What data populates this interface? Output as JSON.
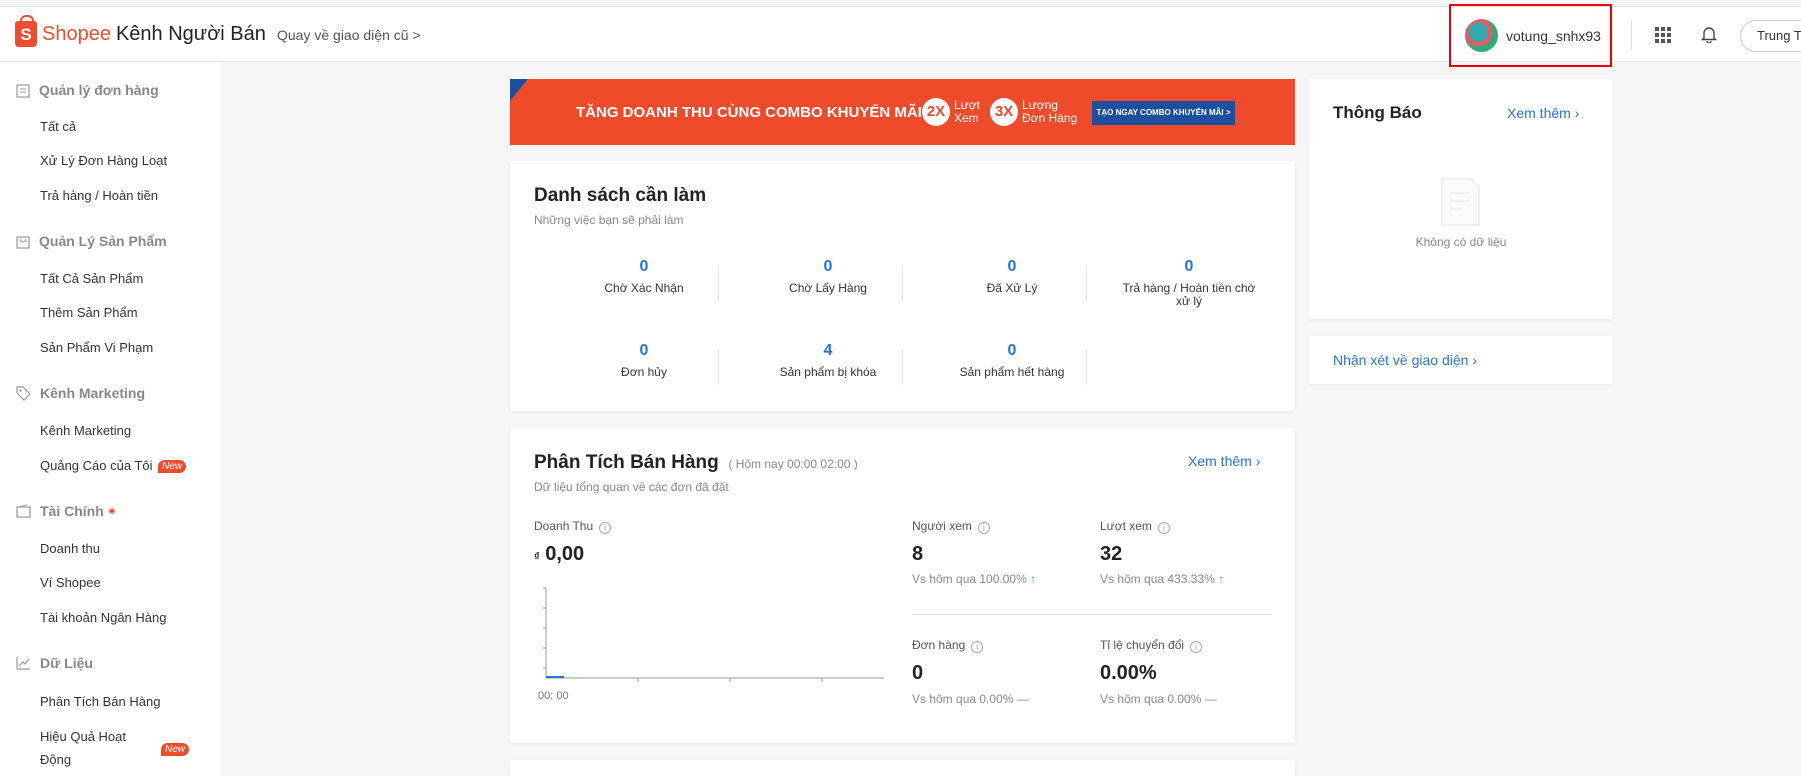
{
  "header": {
    "brand": "Shopee",
    "brand_sub": "Kênh Người Bán",
    "old_ui_link": "Quay về giao diện cũ >",
    "username": "votung_snhx93",
    "region": "Trung Tâm"
  },
  "sidebar": {
    "orders": {
      "title": "Quản lý đơn hàng",
      "items": [
        "Tất cả",
        "Xử Lý Đơn Hàng Loạt",
        "Trả hàng / Hoàn tiền"
      ]
    },
    "products": {
      "title": "Quản Lý Sản Phẩm",
      "items": [
        "Tất Cả Sản Phẩm",
        "Thêm Sản Phẩm",
        "Sản Phẩm Vi Phạm"
      ]
    },
    "marketing": {
      "title": "Kênh Marketing",
      "items": [
        "Kênh Marketing",
        "Quảng Cáo của Tôi"
      ]
    },
    "finance": {
      "title": "Tài Chính",
      "items": [
        "Doanh thu",
        "Ví Shopee",
        "Tài khoản Ngân Hàng"
      ]
    },
    "data": {
      "title": "Dữ Liệu",
      "items": [
        "Phân Tích Bán Hàng",
        "Hiệu Quả Hoạt",
        "Động"
      ]
    },
    "new_badge": "New"
  },
  "banner": {
    "text": "TĂNG DOANH THU CÙNG COMBO KHUYẾN MÃI",
    "x1": "2X",
    "x1_label_a": "Lượt",
    "x1_label_b": "Xem",
    "x2": "3X",
    "x2_label_a": "Lượng",
    "x2_label_b": "Đơn Hàng",
    "cta": "TẠO NGAY COMBO KHUYẾN MÃI >"
  },
  "todo": {
    "title": "Danh sách cần làm",
    "subtitle": "Những việc bạn sẽ phải làm",
    "cells": [
      {
        "value": "0",
        "label": "Chờ Xác Nhận"
      },
      {
        "value": "0",
        "label": "Chờ Lấy Hàng"
      },
      {
        "value": "0",
        "label": "Đã Xử Lý"
      },
      {
        "value": "0",
        "label": "Trả hàng / Hoàn tiền chờ xử lý"
      },
      {
        "value": "0",
        "label": "Đơn hủy"
      },
      {
        "value": "4",
        "label": "Sản phẩm bị khóa"
      },
      {
        "value": "0",
        "label": "Sản phẩm hết hàng"
      }
    ]
  },
  "analytics": {
    "title": "Phân Tích Bán Hàng",
    "time": "( Hôm nay 00:00 02:00 )",
    "subtitle": "Dữ liệu tổng quan về các đơn đã đặt",
    "more": "Xem thêm",
    "revenue_label": "Doanh Thu",
    "currency": "₫",
    "revenue_value": "0,00",
    "chart_x_label": "00: 00",
    "metrics": [
      {
        "label": "Người xem",
        "value": "8",
        "compare": "Vs hôm qua 100.00%"
      },
      {
        "label": "Lượt xem",
        "value": "32",
        "compare": "Vs hôm qua 433.33%"
      },
      {
        "label": "Đơn hàng",
        "value": "0",
        "compare": "Vs hôm qua 0.00% —"
      },
      {
        "label": "Tỉ lệ chuyển đổi",
        "value": "0.00%",
        "compare": "Vs hôm qua 0.00% —"
      }
    ]
  },
  "notice": {
    "title": "Thông Báo",
    "more": "Xem thêm",
    "empty": "Không có dữ liệu"
  },
  "feedback": {
    "text": "Nhận xét về giao diện"
  },
  "colors": {
    "accent": "#ee4d2d",
    "link": "#2673dd",
    "highlight_border": "#e00000"
  }
}
